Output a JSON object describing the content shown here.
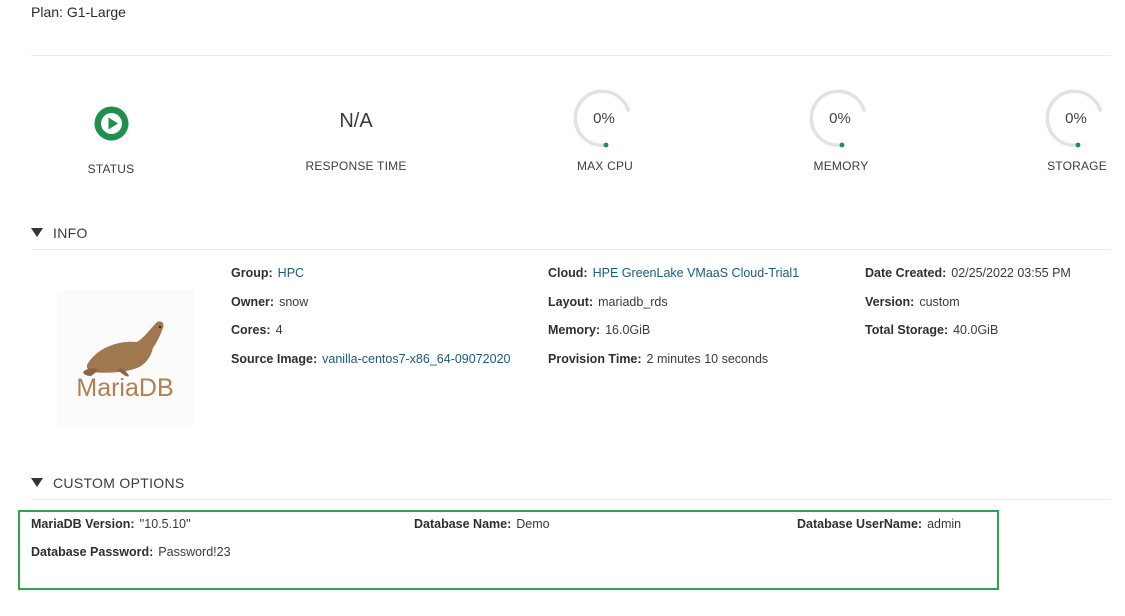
{
  "plan": {
    "label": "Plan:",
    "value": "G1-Large"
  },
  "stats": {
    "status_label": "STATUS",
    "response_time": {
      "value": "N/A",
      "label": "RESPONSE TIME"
    },
    "max_cpu": {
      "value": "0%",
      "label": "MAX CPU",
      "percent": 0
    },
    "memory": {
      "value": "0%",
      "label": "MEMORY",
      "percent": 0
    },
    "storage": {
      "value": "0%",
      "label": "STORAGE",
      "percent": 0
    }
  },
  "colors": {
    "accent_green": "#1f8f4e",
    "highlight_border": "#2aa84a",
    "link": "#1a5a85"
  },
  "info": {
    "title": "INFO",
    "logo_text": "MariaDB",
    "group": {
      "label": "Group:",
      "value": "HPC"
    },
    "owner": {
      "label": "Owner:",
      "value": "snow"
    },
    "cores": {
      "label": "Cores:",
      "value": "4"
    },
    "source_image": {
      "label": "Source Image:",
      "value": "vanilla-centos7-x86_64-09072020"
    },
    "cloud": {
      "label": "Cloud:",
      "value": "HPE GreenLake VMaaS Cloud-Trial1"
    },
    "layout": {
      "label": "Layout:",
      "value": "mariadb_rds"
    },
    "memory": {
      "label": "Memory:",
      "value": "16.0GiB"
    },
    "provision_time": {
      "label": "Provision Time:",
      "value": "2 minutes 10 seconds"
    },
    "date_created": {
      "label": "Date Created:",
      "value": "02/25/2022 03:55 PM"
    },
    "version": {
      "label": "Version:",
      "value": "custom"
    },
    "total_storage": {
      "label": "Total Storage:",
      "value": "40.0GiB"
    }
  },
  "custom_options": {
    "title": "CUSTOM OPTIONS",
    "mariadb_version": {
      "label": "MariaDB Version:",
      "value": "''10.5.10''"
    },
    "database_name": {
      "label": "Database Name:",
      "value": "Demo"
    },
    "database_username": {
      "label": "Database UserName:",
      "value": "admin"
    },
    "database_password": {
      "label": "Database Password:",
      "value": "Password!23"
    }
  }
}
